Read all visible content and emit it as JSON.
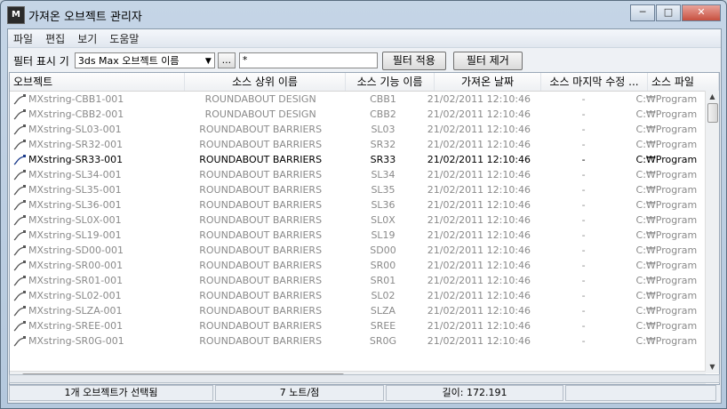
{
  "window": {
    "title": "가져온 오브젝트 관리자",
    "icon_letters": "M"
  },
  "menu": [
    "파일",
    "편집",
    "보기",
    "도움말"
  ],
  "toolbar": {
    "filter_label": "필터 표시 기",
    "filter_type": "3ds Max 오브젝트 이름",
    "browse_label": "...",
    "filter_value": "*",
    "apply_label": "필터 적용",
    "remove_label": "필터 제거"
  },
  "columns": [
    "오브젝트",
    "소스 상위 이름",
    "소스 기능 이름",
    "가져온 날짜",
    "소스 마지막 수정 ...",
    "소스 파일"
  ],
  "rows": [
    {
      "obj": "MXstring-CBB1-001",
      "parent": "ROUNDABOUT DESIGN",
      "feature": "CBB1",
      "date": "21/02/2011 12:10:46",
      "modified": "-",
      "file": "C:₩Program",
      "selected": false
    },
    {
      "obj": "MXstring-CBB2-001",
      "parent": "ROUNDABOUT DESIGN",
      "feature": "CBB2",
      "date": "21/02/2011 12:10:46",
      "modified": "-",
      "file": "C:₩Program",
      "selected": false
    },
    {
      "obj": "MXstring-SL03-001",
      "parent": "ROUNDABOUT BARRIERS",
      "feature": "SL03",
      "date": "21/02/2011 12:10:46",
      "modified": "-",
      "file": "C:₩Program",
      "selected": false
    },
    {
      "obj": "MXstring-SR32-001",
      "parent": "ROUNDABOUT BARRIERS",
      "feature": "SR32",
      "date": "21/02/2011 12:10:46",
      "modified": "-",
      "file": "C:₩Program",
      "selected": false
    },
    {
      "obj": "MXstring-SR33-001",
      "parent": "ROUNDABOUT BARRIERS",
      "feature": "SR33",
      "date": "21/02/2011 12:10:46",
      "modified": "-",
      "file": "C:₩Program",
      "selected": true
    },
    {
      "obj": "MXstring-SL34-001",
      "parent": "ROUNDABOUT BARRIERS",
      "feature": "SL34",
      "date": "21/02/2011 12:10:46",
      "modified": "-",
      "file": "C:₩Program",
      "selected": false
    },
    {
      "obj": "MXstring-SL35-001",
      "parent": "ROUNDABOUT BARRIERS",
      "feature": "SL35",
      "date": "21/02/2011 12:10:46",
      "modified": "-",
      "file": "C:₩Program",
      "selected": false
    },
    {
      "obj": "MXstring-SL36-001",
      "parent": "ROUNDABOUT BARRIERS",
      "feature": "SL36",
      "date": "21/02/2011 12:10:46",
      "modified": "-",
      "file": "C:₩Program",
      "selected": false
    },
    {
      "obj": "MXstring-SL0X-001",
      "parent": "ROUNDABOUT BARRIERS",
      "feature": "SL0X",
      "date": "21/02/2011 12:10:46",
      "modified": "-",
      "file": "C:₩Program",
      "selected": false
    },
    {
      "obj": "MXstring-SL19-001",
      "parent": "ROUNDABOUT BARRIERS",
      "feature": "SL19",
      "date": "21/02/2011 12:10:46",
      "modified": "-",
      "file": "C:₩Program",
      "selected": false
    },
    {
      "obj": "MXstring-SD00-001",
      "parent": "ROUNDABOUT BARRIERS",
      "feature": "SD00",
      "date": "21/02/2011 12:10:46",
      "modified": "-",
      "file": "C:₩Program",
      "selected": false
    },
    {
      "obj": "MXstring-SR00-001",
      "parent": "ROUNDABOUT BARRIERS",
      "feature": "SR00",
      "date": "21/02/2011 12:10:46",
      "modified": "-",
      "file": "C:₩Program",
      "selected": false
    },
    {
      "obj": "MXstring-SR01-001",
      "parent": "ROUNDABOUT BARRIERS",
      "feature": "SR01",
      "date": "21/02/2011 12:10:46",
      "modified": "-",
      "file": "C:₩Program",
      "selected": false
    },
    {
      "obj": "MXstring-SL02-001",
      "parent": "ROUNDABOUT BARRIERS",
      "feature": "SL02",
      "date": "21/02/2011 12:10:46",
      "modified": "-",
      "file": "C:₩Program",
      "selected": false
    },
    {
      "obj": "MXstring-SLZA-001",
      "parent": "ROUNDABOUT BARRIERS",
      "feature": "SLZA",
      "date": "21/02/2011 12:10:46",
      "modified": "-",
      "file": "C:₩Program",
      "selected": false
    },
    {
      "obj": "MXstring-SREE-001",
      "parent": "ROUNDABOUT BARRIERS",
      "feature": "SREE",
      "date": "21/02/2011 12:10:46",
      "modified": "-",
      "file": "C:₩Program",
      "selected": false
    },
    {
      "obj": "MXstring-SR0G-001",
      "parent": "ROUNDABOUT BARRIERS",
      "feature": "SR0G",
      "date": "21/02/2011 12:10:46",
      "modified": "-",
      "file": "C:₩Program",
      "selected": false
    }
  ],
  "status": {
    "selection": "1개 오브젝트가 선택됨",
    "nodes": "7 노트/점",
    "length": "길이: 172.191"
  }
}
